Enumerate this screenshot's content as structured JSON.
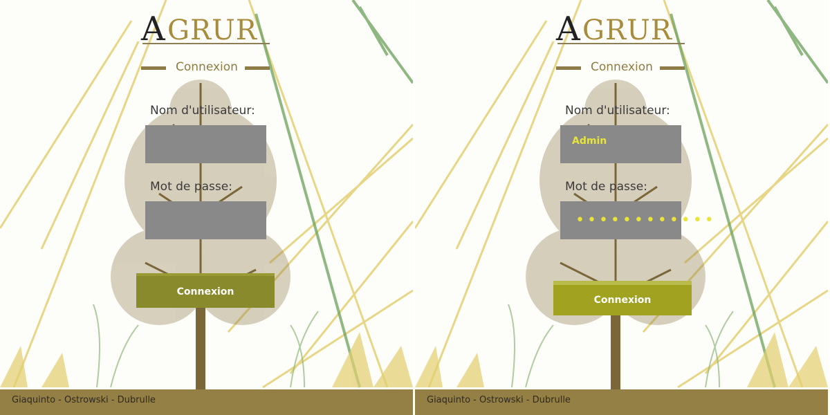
{
  "logo": {
    "first_letter": "A",
    "rest": "GRUR"
  },
  "login": {
    "title": "Connexion",
    "username_label": "Nom d'utilisateur:",
    "password_label": "Mot de passe:",
    "submit_label": "Connexion"
  },
  "left_state": {
    "username": "",
    "password": ""
  },
  "right_state": {
    "username": "Admin",
    "password_mask": "••••••••••••"
  },
  "footer": {
    "credits": "Giaquinto - Ostrowski - Dubrulle"
  },
  "colors": {
    "accent_gold": "#947f45",
    "field_gray": "#898989",
    "button_olive": "#888a2b",
    "button_olive_hover": "#a1a320",
    "entered_text": "#e8e43a"
  }
}
